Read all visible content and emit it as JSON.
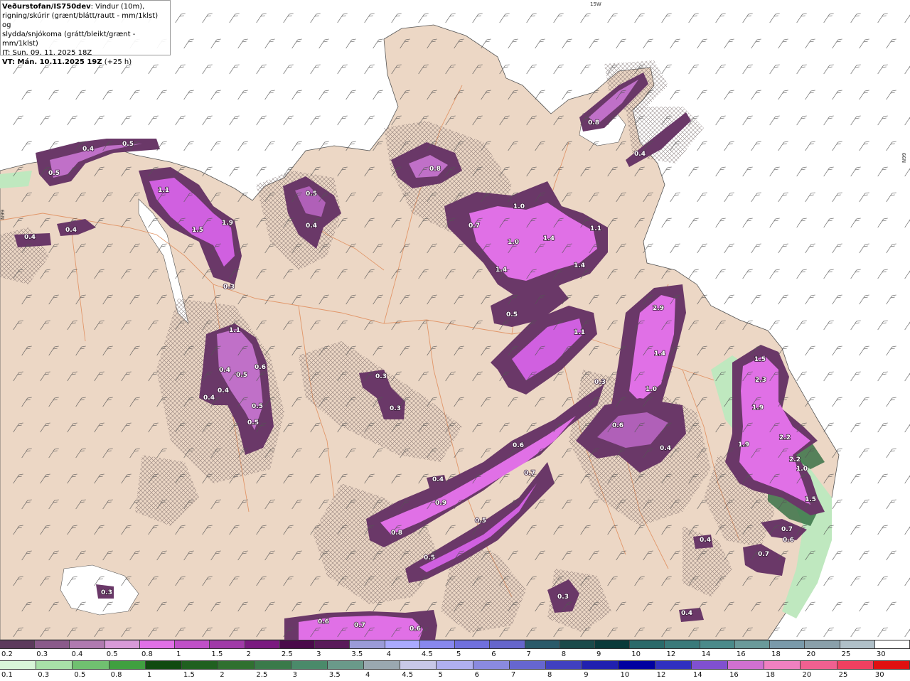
{
  "infobox": {
    "org": "Veðurstofan/IS750dev",
    "line1_rest": ": Vindur (10m),",
    "line2": "rigning/skúrir (grænt/blátt/rautt - mm/1klst) og",
    "line3": "slydda/snjókoma (grátt/bleikt/grænt - mm/1klst)",
    "line4": "IT: Sun. 09. 11. 2025 18Z",
    "line5_bold": "VT: Mán. 10.11.2025 19Z",
    "line5_rest": " (+25 h)"
  },
  "coord_labels": {
    "lon_top": "15W",
    "lat_left": "N99",
    "lat_right": "N99"
  },
  "colors": {
    "ocean": "#ffffff",
    "land": "#ecd7c5",
    "roads": "#e09060",
    "snow_light": "#cf99cf",
    "snow_mid": "#b86ab8",
    "snow_strong": "#e15ce6",
    "snow_dark": "#6a3868",
    "rain_green": "#a8e0a8",
    "rain_dark": "#2f6b3f"
  },
  "precip_labels": [
    {
      "text": "0.5"
    },
    {
      "text": "0.4"
    },
    {
      "text": "0.5"
    },
    {
      "text": "0.4"
    },
    {
      "text": "0.4"
    },
    {
      "text": "1.1"
    },
    {
      "text": "1.5"
    },
    {
      "text": "1.9"
    },
    {
      "text": "0.3"
    },
    {
      "text": "0.5"
    },
    {
      "text": "0.4"
    },
    {
      "text": "0.8"
    },
    {
      "text": "1.0"
    },
    {
      "text": "0.7"
    },
    {
      "text": "1.0"
    },
    {
      "text": "1.4"
    },
    {
      "text": "1.1"
    },
    {
      "text": "1.4"
    },
    {
      "text": "1.4"
    },
    {
      "text": "0.8"
    },
    {
      "text": "0.4"
    },
    {
      "text": "0.5"
    },
    {
      "text": "1.1"
    },
    {
      "text": "2.9"
    },
    {
      "text": "1.4"
    },
    {
      "text": "1.0"
    },
    {
      "text": "0.3"
    },
    {
      "text": "0.6"
    },
    {
      "text": "0.4"
    },
    {
      "text": "1.1"
    },
    {
      "text": "0.4"
    },
    {
      "text": "0.5"
    },
    {
      "text": "0.6"
    },
    {
      "text": "0.4"
    },
    {
      "text": "0.4"
    },
    {
      "text": "0.5"
    },
    {
      "text": "0.5"
    },
    {
      "text": "0.3"
    },
    {
      "text": "0.3"
    },
    {
      "text": "0.6"
    },
    {
      "text": "0.7"
    },
    {
      "text": "0.4"
    },
    {
      "text": "0.9"
    },
    {
      "text": "0.8"
    },
    {
      "text": "0.5"
    },
    {
      "text": "0.5"
    },
    {
      "text": "1.5"
    },
    {
      "text": "2.3"
    },
    {
      "text": "1.9"
    },
    {
      "text": "2.2"
    },
    {
      "text": "1.9"
    },
    {
      "text": "2.2"
    },
    {
      "text": "1.0"
    },
    {
      "text": "1.5"
    },
    {
      "text": "0.7"
    },
    {
      "text": "0.6"
    },
    {
      "text": "0.7"
    },
    {
      "text": "0.4"
    },
    {
      "text": "0.3"
    },
    {
      "text": "0.4"
    },
    {
      "text": "0.6"
    },
    {
      "text": "0.7"
    },
    {
      "text": "0.6"
    },
    {
      "text": "0.3"
    }
  ],
  "legend_snow": {
    "labels": [
      "0.2",
      "0.3",
      "0.4",
      "0.5",
      "0.8",
      "1",
      "1.5",
      "2",
      "2.5",
      "3",
      "3.5",
      "4",
      "4.5",
      "5",
      "6",
      "7",
      "8",
      "9",
      "10",
      "12",
      "14",
      "16",
      "18",
      "20",
      "25",
      "30"
    ],
    "colors": [
      "#5c3a5c",
      "#8a5a8a",
      "#b07ab0",
      "#d89ad8",
      "#e070e6",
      "#c050c8",
      "#a03aa8",
      "#7a1a80",
      "#4a0a4a",
      "#5a1a5a",
      "#9b9bd8",
      "#aaaaff",
      "#8888ee",
      "#7070dd",
      "#6666cc",
      "#2a5a6a",
      "#1a4a4a",
      "#0a3a3a",
      "#2a6a6a",
      "#3a7a7a",
      "#4a8a8a",
      "#6a9a9a",
      "#7a9aaa",
      "#8aa0aa",
      "#b0c0c8",
      "#ffffff"
    ]
  },
  "legend_rain": {
    "labels": [
      "0.1",
      "0.3",
      "0.5",
      "0.8",
      "1",
      "1.5",
      "2",
      "2.5",
      "3",
      "3.5",
      "4",
      "4.5",
      "5",
      "6",
      "7",
      "8",
      "9",
      "10",
      "12",
      "14",
      "16",
      "18",
      "20",
      "25",
      "30"
    ],
    "colors": [
      "#d8f5d8",
      "#a8e0a8",
      "#70c070",
      "#40a040",
      "#104a10",
      "#206020",
      "#307030",
      "#3a7a4a",
      "#4a8a6a",
      "#6a9a8a",
      "#9aa8b0",
      "#c8c8e8",
      "#b0b0f0",
      "#8a8ae0",
      "#6666d0",
      "#4040c0",
      "#2020b0",
      "#0000a0",
      "#3030c0",
      "#8050d0",
      "#d070d0",
      "#f080c0",
      "#f06090",
      "#f04060",
      "#e01010"
    ]
  }
}
